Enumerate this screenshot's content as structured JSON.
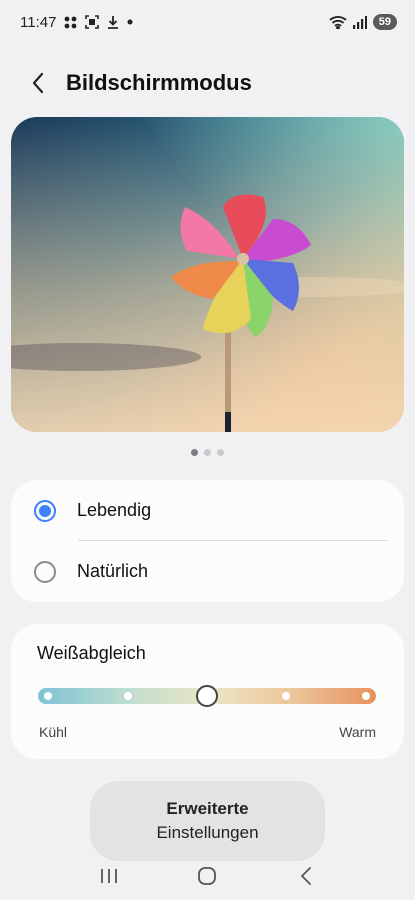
{
  "status_bar": {
    "time": "11:47",
    "notification_icons": [
      "grid-icon",
      "screenshot-icon",
      "download-icon",
      "dot-icon"
    ],
    "system_icons": [
      "wifi-icon",
      "signal-icon"
    ],
    "battery": "59"
  },
  "header": {
    "back_icon": "chevron-left-icon",
    "title": "Bildschirmmodus"
  },
  "preview": {
    "image": "pinwheel-photo",
    "page_count": 3,
    "current_page": 1
  },
  "screen_mode": {
    "options": [
      {
        "label": "Lebendig",
        "selected": true
      },
      {
        "label": "Natürlich",
        "selected": false
      }
    ],
    "accent_color": "#3e82f7"
  },
  "white_balance": {
    "title": "Weißabgleich",
    "min_label": "Kühl",
    "max_label": "Warm",
    "steps": 5,
    "value_index": 2
  },
  "advanced_button": {
    "line1": "Erweiterte",
    "line2": "Einstellungen"
  },
  "nav_bar": {
    "icons": [
      "recent-apps-icon",
      "home-icon",
      "back-icon"
    ]
  }
}
